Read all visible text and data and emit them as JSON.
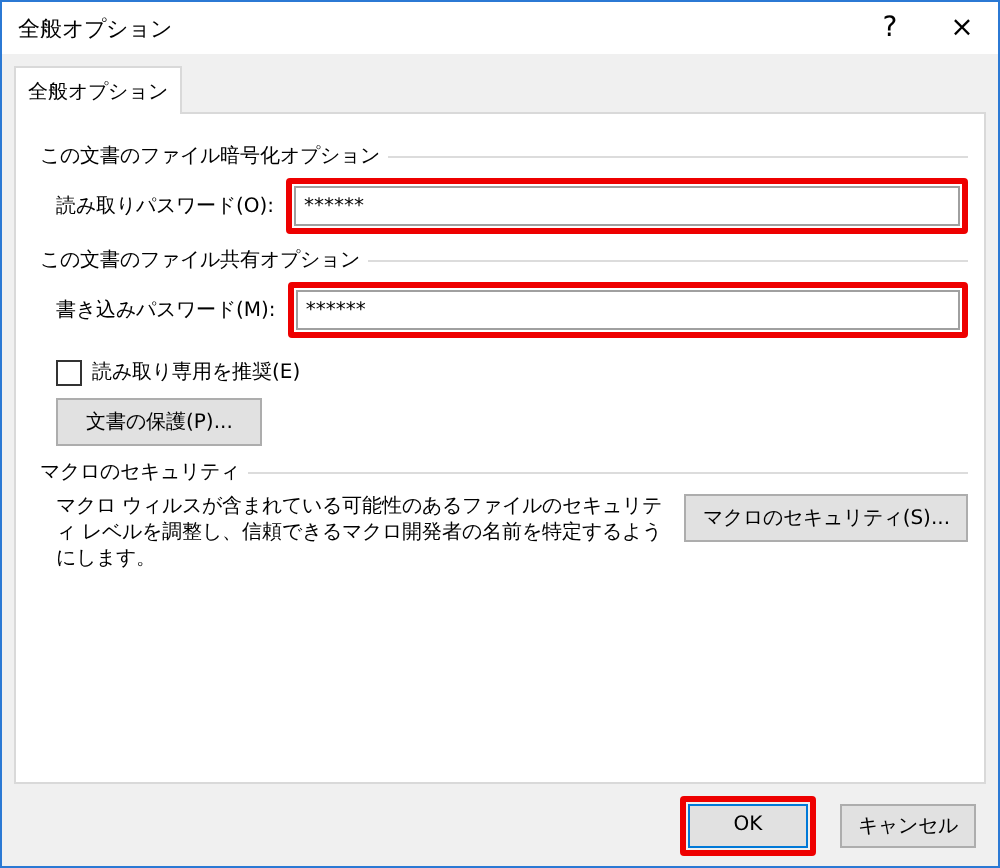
{
  "window": {
    "title": "全般オプション",
    "help": "?",
    "close": "×"
  },
  "tabs": [
    {
      "label": "全般オプション",
      "selected": true
    }
  ],
  "sections": [
    {
      "kind": "password",
      "title": "この文書のファイル暗号化オプション",
      "label": "読み取りパスワード(O):",
      "value": "******",
      "highlighted": true
    },
    {
      "kind": "password",
      "title": "この文書のファイル共有オプション",
      "label": "書き込みパスワード(M):",
      "value": "******",
      "highlighted": true
    }
  ],
  "readonly": {
    "label": "読み取り専用を推奨(E)",
    "checked": false
  },
  "protect_button": "文書の保護(P)...",
  "macro": {
    "title": "マクロのセキュリティ",
    "description": "マクロ ウィルスが含まれている可能性のあるファイルのセキュリティ レベルを調整し、信頼できるマクロ開発者の名前を特定するようにします。",
    "button": "マクロのセキュリティ(S)..."
  },
  "buttons": [
    {
      "label": "OK",
      "default": true,
      "highlighted": true
    },
    {
      "label": "キャンセル",
      "default": false,
      "highlighted": false
    }
  ]
}
